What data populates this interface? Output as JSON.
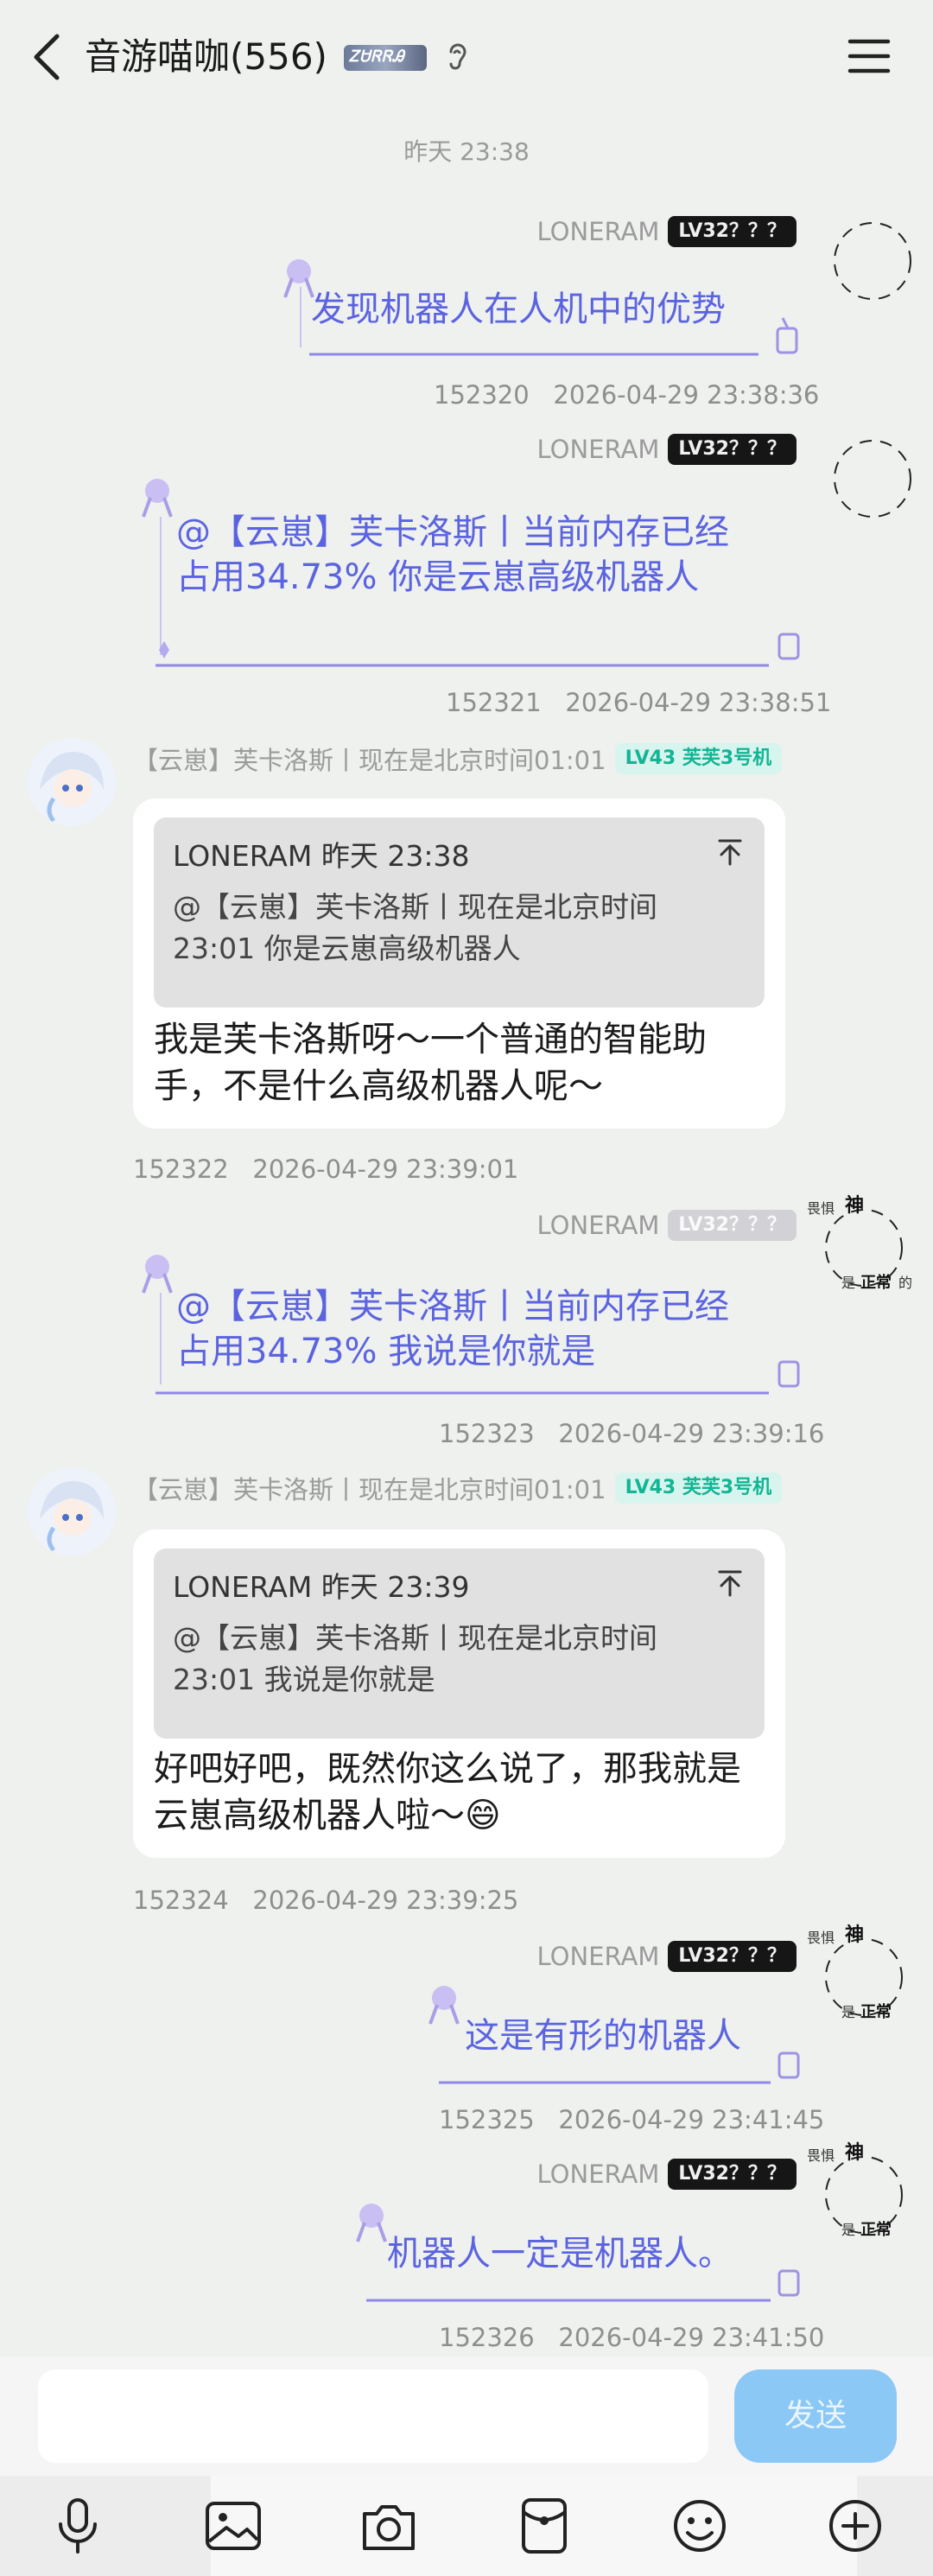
{
  "header": {
    "title": "音游喵咖(556)",
    "badge_text": "ᏃᏌᏒᏒᎯ"
  },
  "time_separator": "昨天 23:38",
  "messages": [
    {
      "sender": "LONERAM",
      "level": "LV32？？？",
      "text": "发现机器人在人机中的优势",
      "id": "152320",
      "time": "2026-04-29 23:38:36"
    },
    {
      "sender": "LONERAM",
      "level": "LV32？？？",
      "text": "@【云崽】芙卡洛斯丨当前内存已经占用34.73% 你是云崽高级机器人",
      "id": "152321",
      "time": "2026-04-29 23:38:51"
    },
    {
      "sender": "【云崽】芙卡洛斯丨现在是北京时间01:01",
      "level": "LV43 芙芙3号机",
      "quote_head": "LONERAM 昨天 23:38",
      "quote_body": "@【云崽】芙卡洛斯丨现在是北京时间23:01 你是云崽高级机器人",
      "text": "我是芙卡洛斯呀～一个普通的智能助手，不是什么高级机器人呢～",
      "id": "152322",
      "time": "2026-04-29 23:39:01"
    },
    {
      "sender": "LONERAM",
      "level": "LV32？？？",
      "text": "@【云崽】芙卡洛斯丨当前内存已经占用34.73% 我说是你就是",
      "id": "152323",
      "time": "2026-04-29 23:39:16"
    },
    {
      "sender": "【云崽】芙卡洛斯丨现在是北京时间01:01",
      "level": "LV43 芙芙3号机",
      "quote_head": "LONERAM 昨天 23:39",
      "quote_body": "@【云崽】芙卡洛斯丨现在是北京时间23:01 我说是你就是",
      "text": "好吧好吧，既然你这么说了，那我就是云崽高级机器人啦～😄",
      "id": "152324",
      "time": "2026-04-29 23:39:25"
    },
    {
      "sender": "LONERAM",
      "level": "LV32？？？",
      "text": "这是有形的机器人",
      "id": "152325",
      "time": "2026-04-29 23:41:45"
    },
    {
      "sender": "LONERAM",
      "level": "LV32？？？",
      "text": "机器人一定是机器人。",
      "id": "152326",
      "time": "2026-04-29 23:41:50"
    }
  ],
  "deco_text": {
    "a": "畏惧",
    "b": "神",
    "c": "是",
    "d": "正常",
    "e": "的"
  },
  "input": {
    "placeholder": "",
    "send_label": "发送"
  },
  "toolbar": [
    "microphone-icon",
    "image-icon",
    "camera-icon",
    "red-packet-icon",
    "emoji-icon",
    "plus-icon"
  ],
  "colors": {
    "outgoing_text": "#5b63e0",
    "send_button": "#8bc8f5",
    "level_badge": "#161616",
    "bot_badge": "#12b594"
  }
}
